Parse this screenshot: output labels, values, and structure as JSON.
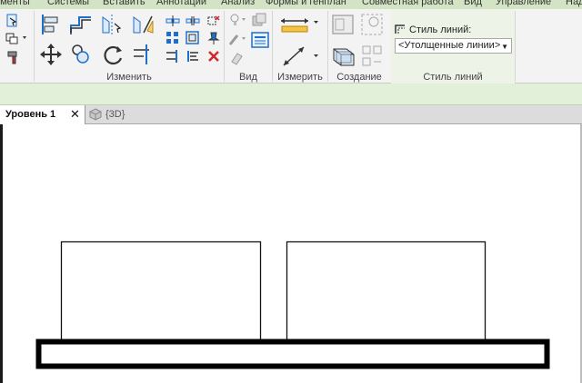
{
  "menu_tabs": [
    "ементы",
    "Системы",
    "Вставить",
    "Аннотации",
    "Анализ",
    "Формы и генплан",
    "Совместная работа",
    "Вид",
    "Управление",
    "Над"
  ],
  "panels": {
    "modify": "Изменить",
    "view": "Вид",
    "measure": "Измерить",
    "create": "Создание",
    "line_style": "Стиль линий"
  },
  "line_style": {
    "label": "Стиль линий:",
    "selected": "<Утолщенные линии>"
  },
  "view_tabs": {
    "active": "Уровень 1",
    "close": "✕",
    "other": "{3D}"
  },
  "colors": {
    "blue": "#1e6fc9",
    "red": "#d4262b",
    "ribbon_green": "#e2efd9"
  }
}
